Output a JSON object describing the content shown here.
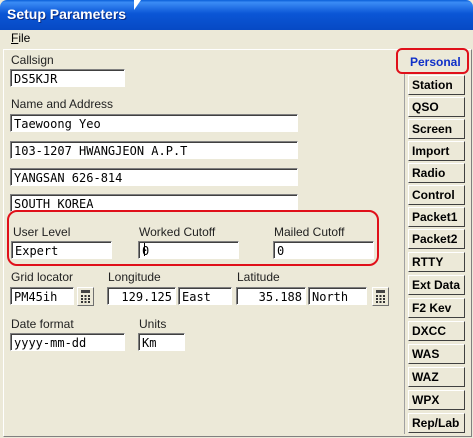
{
  "window": {
    "title": "Setup Parameters"
  },
  "menu": {
    "file_label_underlined": "F",
    "file_label_rest": "ile"
  },
  "form": {
    "callsign": {
      "label": "Callsign",
      "value": "DS5KJR"
    },
    "name_address": {
      "label": "Name and Address",
      "line1": "Taewoong Yeo",
      "line2": "103-1207 HWANGJEON A.P.T",
      "line3": "YANGSAN 626-814",
      "line4": "SOUTH KOREA"
    },
    "user_level": {
      "label": "User Level",
      "value": "Expert"
    },
    "worked_cutoff": {
      "label": "Worked Cutoff",
      "value": "0"
    },
    "mailed_cutoff": {
      "label": "Mailed Cutoff",
      "value": "0"
    },
    "grid_locator": {
      "label": "Grid locator",
      "value": "PM45ih"
    },
    "longitude": {
      "label": "Longitude",
      "value": "129.125",
      "direction": "East"
    },
    "latitude": {
      "label": "Latitude",
      "value": "35.188",
      "direction": "North"
    },
    "date_format": {
      "label": "Date format",
      "value": "yyyy-mm-dd"
    },
    "units": {
      "label": "Units",
      "value": "Km"
    }
  },
  "tabs": [
    {
      "label": "Personal",
      "active": true
    },
    {
      "label": "Station"
    },
    {
      "label": "QSO"
    },
    {
      "label": "Screen"
    },
    {
      "label": "Import"
    },
    {
      "label": "Radio"
    },
    {
      "label": "Control"
    },
    {
      "label": "Packet1"
    },
    {
      "label": "Packet2"
    },
    {
      "label": "RTTY"
    },
    {
      "label": "Ext Data"
    },
    {
      "label": "F2 Kev"
    },
    {
      "label": "DXCC"
    },
    {
      "label": "WAS"
    },
    {
      "label": "WAZ"
    },
    {
      "label": "WPX"
    },
    {
      "label": "Rep/Lab"
    }
  ],
  "colors": {
    "title_bar": "#0b56d6",
    "highlight": "#e0101a",
    "active_tab_text": "#1030c8",
    "panel": "#ece9d8"
  },
  "icons": {
    "calculator": "calculator-icon",
    "cursor": "mouse-cursor-icon"
  }
}
